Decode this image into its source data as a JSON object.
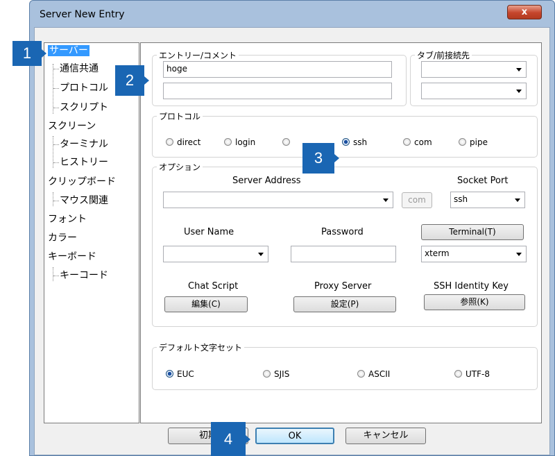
{
  "window": {
    "title": "Server New Entry",
    "close_label": "x"
  },
  "tree": [
    {
      "label": "サーバー",
      "level": 0
    },
    {
      "label": "通信共通",
      "level": 1
    },
    {
      "label": "プロトコル",
      "level": 1
    },
    {
      "label": "スクリプト",
      "level": 1
    },
    {
      "label": "スクリーン",
      "level": 0
    },
    {
      "label": "ターミナル",
      "level": 1
    },
    {
      "label": "ヒストリー",
      "level": 1
    },
    {
      "label": "クリップボード",
      "level": 0
    },
    {
      "label": "マウス関連",
      "level": 1
    },
    {
      "label": "フォント",
      "level": 0
    },
    {
      "label": "カラー",
      "level": 0
    },
    {
      "label": "キーボード",
      "level": 0
    },
    {
      "label": "キーコード",
      "level": 1
    }
  ],
  "entry": {
    "legend": "エントリー/コメント",
    "entry_value": "hoge",
    "comment_value": ""
  },
  "tab": {
    "legend": "タブ/前接続先",
    "tab_value": "",
    "prev_value": ""
  },
  "protocol": {
    "legend": "プロトコル",
    "options": [
      "direct",
      "login",
      "",
      "ssh",
      "com",
      "pipe"
    ],
    "selected": "ssh"
  },
  "options": {
    "legend": "オプション",
    "server_address_label": "Server Address",
    "server_address_value": "",
    "com_button": "com",
    "socket_port_label": "Socket Port",
    "socket_port_value": "ssh",
    "user_name_label": "User Name",
    "user_name_value": "",
    "password_label": "Password",
    "password_value": "",
    "terminal_button": "Terminal(T)",
    "terminal_value": "xterm",
    "chat_script_label": "Chat Script",
    "chat_script_button": "編集(C)",
    "proxy_server_label": "Proxy Server",
    "proxy_server_button": "設定(P)",
    "ssh_key_label": "SSH Identity Key",
    "ssh_key_button": "参照(K)"
  },
  "charset": {
    "legend": "デフォルト文字セット",
    "options": [
      "EUC",
      "SJIS",
      "ASCII",
      "UTF-8"
    ],
    "selected": "EUC"
  },
  "buttons": {
    "init": "初期",
    "ok": "OK",
    "cancel": "キャンセル"
  },
  "callouts": [
    "1",
    "2",
    "3",
    "4"
  ],
  "colors": {
    "callout": "#1a66b3",
    "selection": "#3399ff",
    "frame": "#a9c1dd"
  }
}
